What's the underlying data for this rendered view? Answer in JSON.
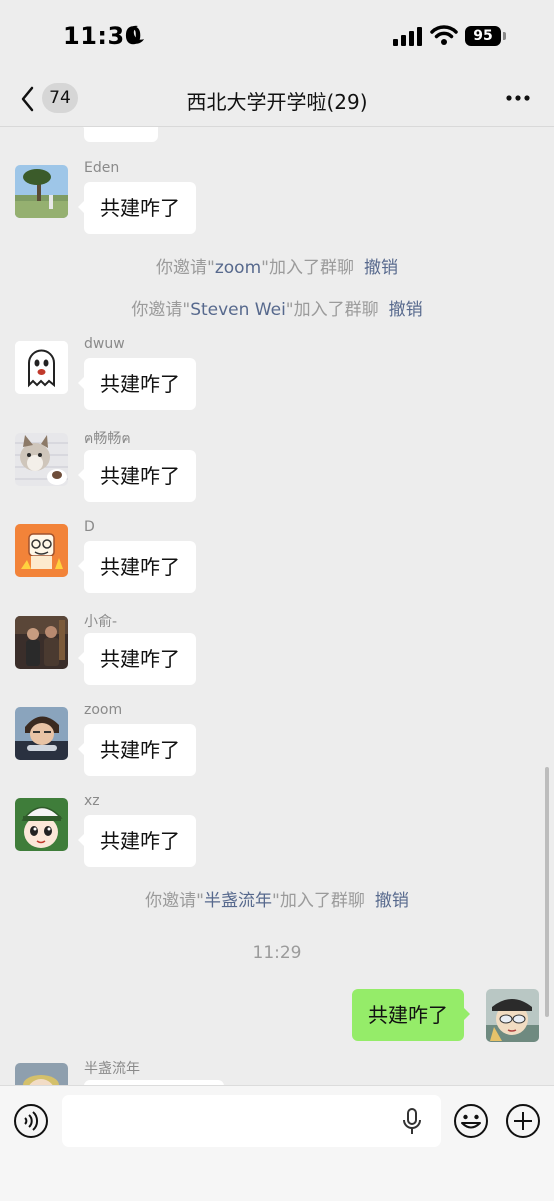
{
  "status": {
    "time": "11:30",
    "battery": "95"
  },
  "nav": {
    "back_count": "74",
    "title": "西北大学开学啦(29)"
  },
  "messages": [
    {
      "sender": "Eden",
      "text": "共建咋了"
    },
    {
      "sender": "dwuw",
      "text": "共建咋了"
    },
    {
      "sender": "ฅ畅畅ฅ",
      "text": "共建咋了"
    },
    {
      "sender": "D",
      "text": "共建咋了"
    },
    {
      "sender": "小俞-",
      "text": "共建咋了"
    },
    {
      "sender": "zoom",
      "text": "共建咋了"
    },
    {
      "sender": "xz",
      "text": "共建咋了"
    },
    {
      "sender": "半盏流年",
      "text": ""
    }
  ],
  "system": [
    {
      "prefix": "你邀请\"",
      "name": "zoom",
      "suffix": "\"加入了群聊",
      "action": "撤销"
    },
    {
      "prefix": "你邀请\"",
      "name": "Steven Wei",
      "suffix": "\"加入了群聊",
      "action": "撤销"
    },
    {
      "prefix": "你邀请\"",
      "name": "半盏流年",
      "suffix": "\"加入了群聊",
      "action": "撤销"
    }
  ],
  "timestamp": "11:29",
  "my_message": "共建咋了",
  "input": {
    "value": "",
    "placeholder": ""
  },
  "colors": {
    "background": "#ededed",
    "my_bubble": "#95ec69",
    "link": "#57698d"
  },
  "icons": [
    "back-icon",
    "more-icon",
    "voice-icon",
    "mic-icon",
    "emoji-icon",
    "plus-icon",
    "moon-icon",
    "signal-icon",
    "wifi-icon"
  ]
}
